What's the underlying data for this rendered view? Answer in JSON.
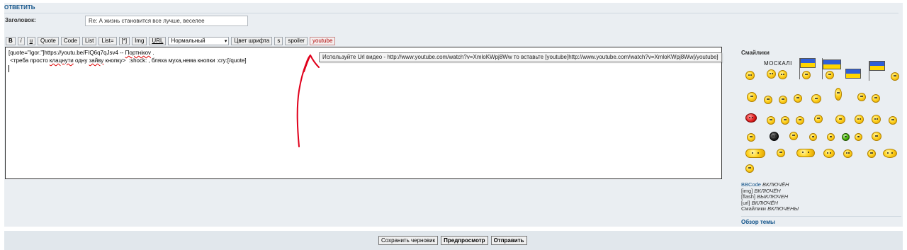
{
  "form": {
    "section_title": "ОТВЕТИТЬ",
    "subject_label": "Заголовок:",
    "subject_value": "Re: А жизнь становится все лучше, веселее"
  },
  "toolbar": {
    "bold": "B",
    "italic": "i",
    "underline": "u",
    "quote": "Quote",
    "code": "Code",
    "list": "List",
    "list_eq": "List=",
    "list_item": "[*]",
    "img": "Img",
    "url": "URL",
    "font_size_selected": "Нормальный",
    "font_color": "Цвет шрифта",
    "s": "s",
    "spoiler": "spoiler",
    "youtube": "youtube",
    "youtube_color": "#b00000"
  },
  "editor": {
    "line1_a": "[quote=\"Igor.\"]https://youtu.be/FIQ6q7qJsv4 -- ",
    "line1_b": "Портнікоv",
    "line1_c": " .",
    "line2_a": " <треба просто ",
    "line2_b": "клацнути",
    "line2_c": " одну ",
    "line2_d": "зайву",
    "line2_e": " кнопку>  :shock: , бляха муха,нема кнопки :cry:[/quote]"
  },
  "tooltip": {
    "text": "Используйте Url видео - http://www.youtube.com/watch?v=XmloKWpj8Ww то вставьте [youtube]http://www.youtube.com/watch?v=XmloKWpj8Ww[/youtube]"
  },
  "smilies": {
    "title": "Смайлики",
    "moskali_text": "МОСКАЛІ"
  },
  "options": {
    "bbcode_label": "BBCode",
    "bbcode_state": "ВКЛЮЧЁН",
    "img_label": "[img]",
    "img_state": "ВКЛЮЧЁН",
    "flash_label": "[flash]",
    "flash_state": "ВЫКЛЮЧЕН",
    "url_label": "[url]",
    "url_state": "ВКЛЮЧЁН",
    "smilies_label": "Смайлики",
    "smilies_state": "ВКЛЮЧЕНЫ",
    "topic_review": "Обзор темы"
  },
  "footer": {
    "save_draft": "Сохранить черновик",
    "preview": "Предпросмотр",
    "submit": "Отправить"
  },
  "colors": {
    "annotation_arrow": "#e0001b",
    "panel_bg": "#eaeef2",
    "link": "#105289"
  }
}
